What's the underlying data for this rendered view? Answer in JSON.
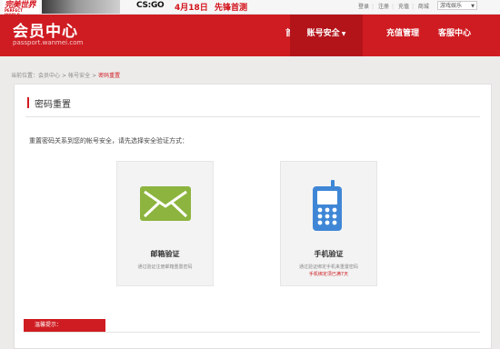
{
  "topbar": {
    "logo_main": "完美世界",
    "logo_sub": "PERFECT WORLD",
    "promo_game": "CS:GO",
    "promo_date": "4月18日",
    "promo_text": "先锋首测",
    "links": [
      "登录",
      "注册",
      "充值",
      "商城"
    ],
    "game_select": "游戏娱乐"
  },
  "header": {
    "brand": "会员中心",
    "brand_sub": "passport.wanmei.com",
    "nav": {
      "home": "首页",
      "account": "账号安全",
      "recharge": "充值管理",
      "service": "客服中心"
    }
  },
  "breadcrumb": {
    "items": [
      "当前位置：",
      "会员中心",
      "帐号安全",
      "密码重置"
    ]
  },
  "main": {
    "title": "密码重置",
    "intro": "重置密码关系到您的帐号安全，请先选择安全验证方式：",
    "email_card": {
      "name": "邮箱验证",
      "desc": "通过验证注册邮箱重置密码",
      "icon": "envelope-icon"
    },
    "phone_card": {
      "name": "手机验证",
      "desc": "通过验证绑定手机来重置密码",
      "note": "手机绑定须已满7天",
      "icon": "mobile-phone-icon"
    },
    "tip_label": "温馨提示："
  },
  "colors": {
    "brand_red": "#cf1c22",
    "email_green": "#8cb43e",
    "phone_blue": "#3f87d6"
  }
}
